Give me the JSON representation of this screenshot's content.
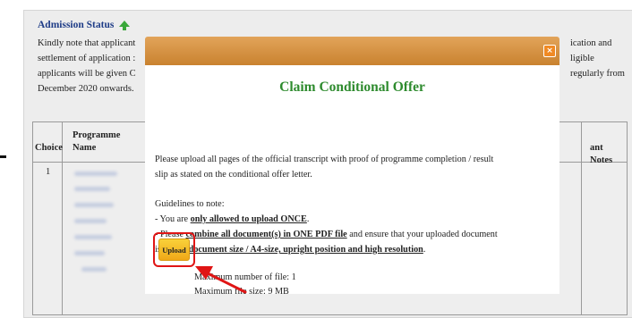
{
  "background": {
    "status_title": "Admission Status",
    "lines": [
      {
        "left": "Kindly note that applicant",
        "right": "ication and"
      },
      {
        "left": "settlement of application :",
        "right": "ligible"
      },
      {
        "left": "applicants will be given C",
        "right": "regularly from"
      },
      {
        "left": "December 2020 onwards."
      }
    ],
    "table": {
      "col_choice": "Choice",
      "col_programme_line1": "Programme",
      "col_programme_line2": "Name",
      "col_notes": "ant Notes",
      "row1_choice": "1"
    }
  },
  "modal": {
    "close_symbol": "×",
    "title": "Claim Conditional Offer",
    "intro_line1": "Please upload all pages of the official transcript with proof of programme completion / result",
    "intro_line2": "slip as stated on the conditional offer letter.",
    "guidelines_heading": "Guidelines to note:",
    "g1_prefix": "- You are ",
    "g1_emph": "only allowed to upload ONCE",
    "g1_suffix": ".",
    "g2_prefix": "- Please ",
    "g2_emph": "combine all document(s) in ONE PDF file",
    "g2_suffix": " and ensure that your uploaded document",
    "g3_prefix": "is ",
    "g3_emph": "in full document size / A4-size, upright position and high resolution",
    "g3_suffix": ".",
    "upload_label": "Upload",
    "max_files": "Maximum number of file: 1",
    "max_size": "Maximum file size: 9 MB"
  },
  "colors": {
    "modal_header": "#d6913f",
    "title_green": "#2e8b2e",
    "annotation_red": "#e01515",
    "upload_yellow": "#f5be28"
  }
}
